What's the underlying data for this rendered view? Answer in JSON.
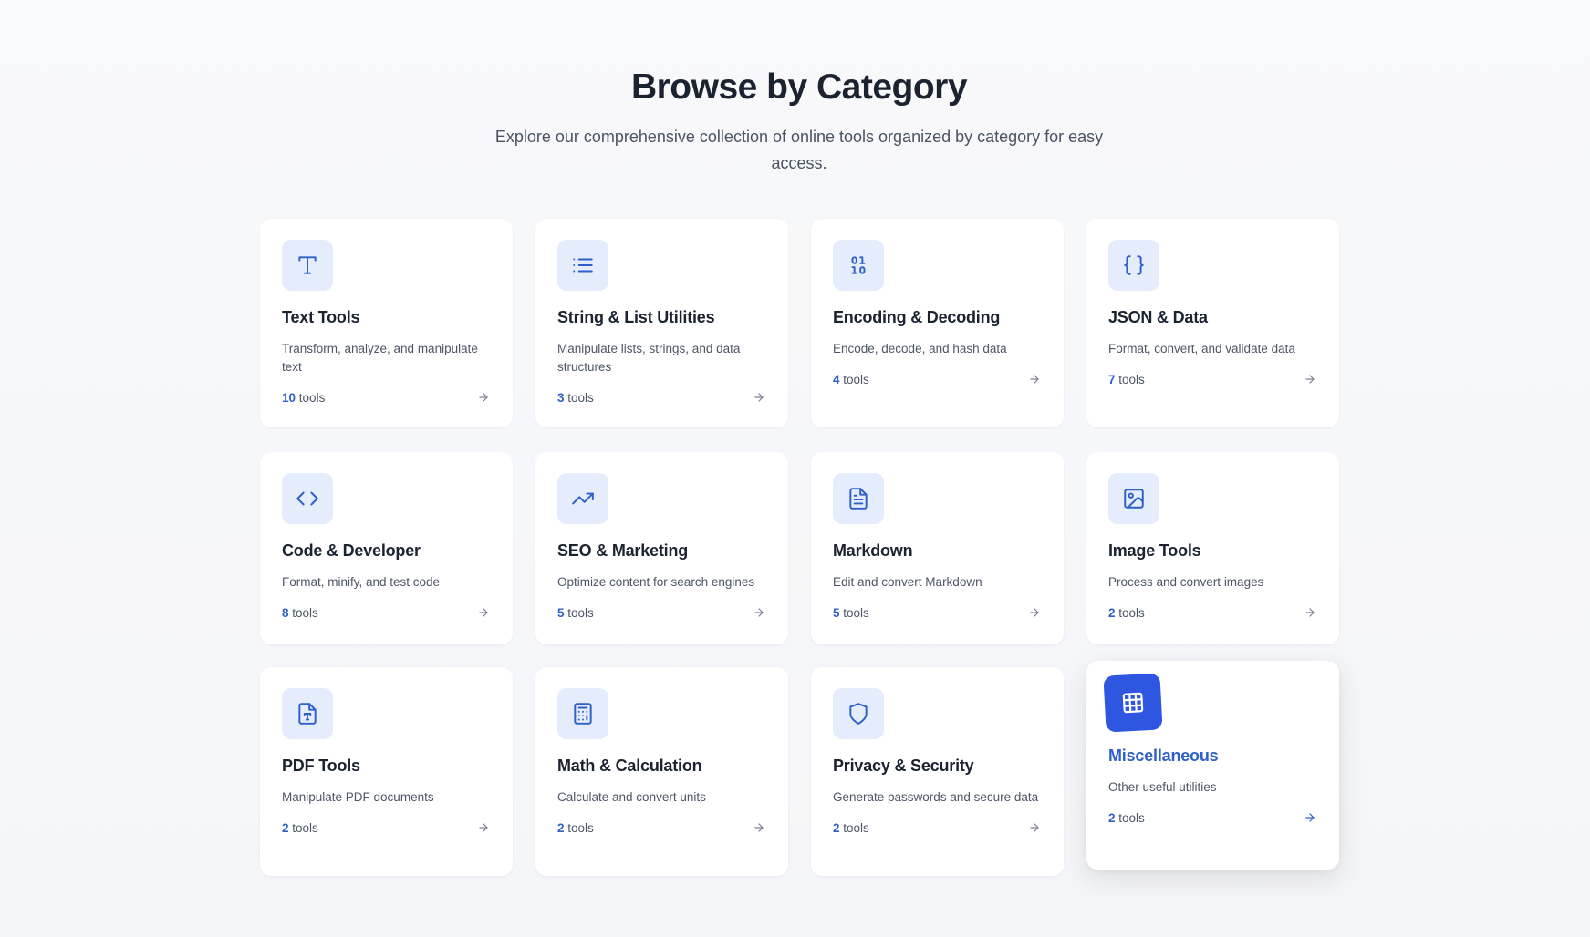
{
  "header": {
    "title": "Browse by Category",
    "subtitle": "Explore our comprehensive collection of online tools organized by category for easy access."
  },
  "categories": [
    {
      "icon": "type-icon",
      "title": "Text Tools",
      "description": "Transform, analyze, and manipulate text",
      "count": "10",
      "unit": "tools"
    },
    {
      "icon": "list-icon",
      "title": "String & List Utilities",
      "description": "Manipulate lists, strings, and data structures",
      "count": "3",
      "unit": "tools"
    },
    {
      "icon": "binary-icon",
      "title": "Encoding & Decoding",
      "description": "Encode, decode, and hash data",
      "count": "4",
      "unit": "tools"
    },
    {
      "icon": "braces-icon",
      "title": "JSON & Data",
      "description": "Format, convert, and validate data",
      "count": "7",
      "unit": "tools"
    },
    {
      "icon": "code-icon",
      "title": "Code & Developer",
      "description": "Format, minify, and test code",
      "count": "8",
      "unit": "tools"
    },
    {
      "icon": "trending-up-icon",
      "title": "SEO & Marketing",
      "description": "Optimize content for search engines",
      "count": "5",
      "unit": "tools"
    },
    {
      "icon": "file-text-icon",
      "title": "Markdown",
      "description": "Edit and convert Markdown",
      "count": "5",
      "unit": "tools"
    },
    {
      "icon": "image-icon",
      "title": "Image Tools",
      "description": "Process and convert images",
      "count": "2",
      "unit": "tools"
    },
    {
      "icon": "file-type-icon",
      "title": "PDF Tools",
      "description": "Manipulate PDF documents",
      "count": "2",
      "unit": "tools"
    },
    {
      "icon": "calculator-icon",
      "title": "Math & Calculation",
      "description": "Calculate and convert units",
      "count": "2",
      "unit": "tools"
    },
    {
      "icon": "shield-icon",
      "title": "Privacy & Security",
      "description": "Generate passwords and secure data",
      "count": "2",
      "unit": "tools"
    },
    {
      "icon": "grid-icon",
      "title": "Miscellaneous",
      "description": "Other useful utilities",
      "count": "2",
      "unit": "tools"
    }
  ],
  "colors": {
    "accent": "#2f5fc8",
    "active_icon_bg": "#2f56e0",
    "icon_bg": "#e5ecfb"
  }
}
